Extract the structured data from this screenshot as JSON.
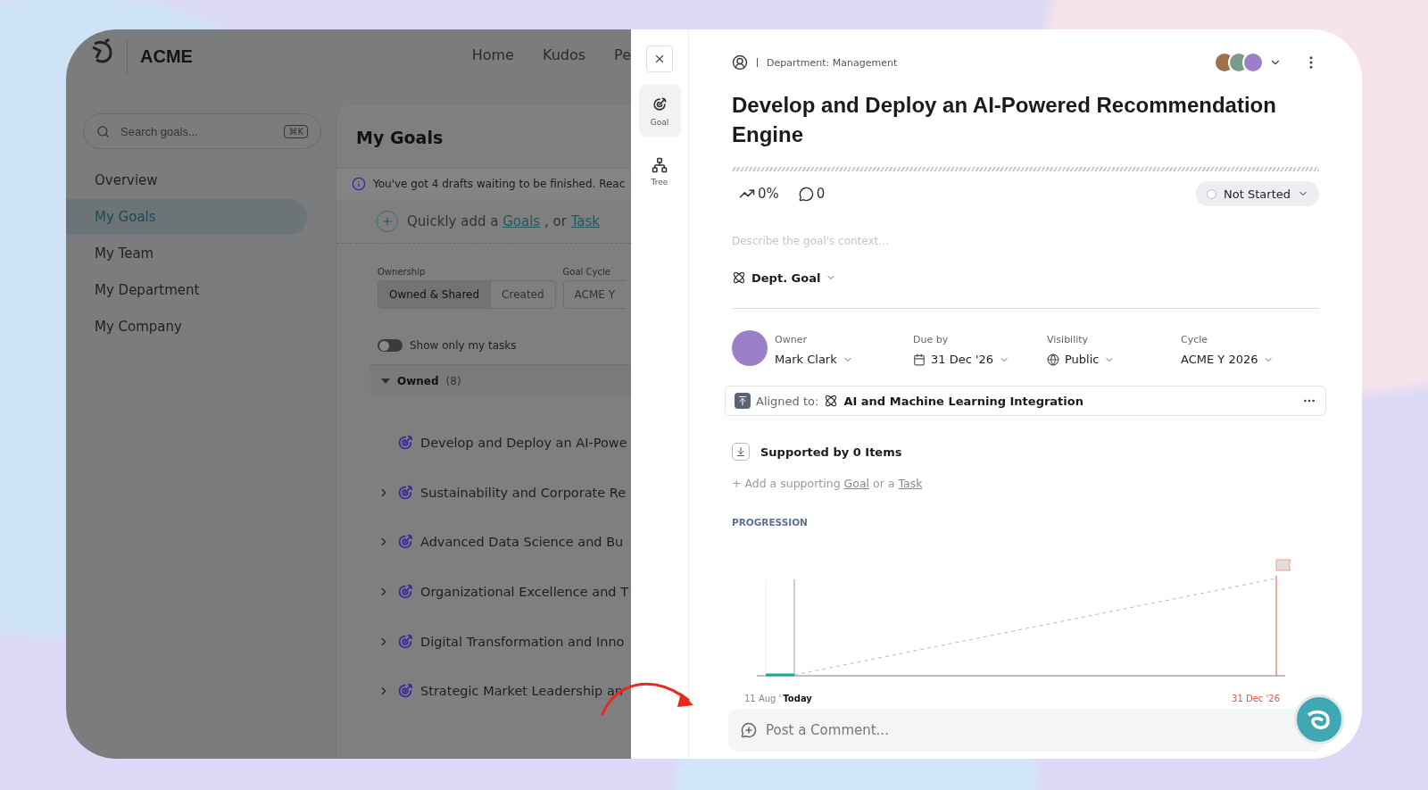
{
  "app": {
    "brand": "ACME",
    "nav": [
      {
        "label": "Home"
      },
      {
        "label": "Kudos"
      },
      {
        "label": "Pe"
      }
    ],
    "search": {
      "placeholder": "Search goals...",
      "shortcut": "⌘K"
    },
    "sidebar": {
      "items": [
        {
          "label": "Overview",
          "selected": false
        },
        {
          "label": "My Goals",
          "selected": true
        },
        {
          "label": "My Team",
          "selected": false
        },
        {
          "label": "My Department",
          "selected": false
        },
        {
          "label": "My Company",
          "selected": false
        }
      ]
    },
    "main": {
      "title": "My Goals",
      "notice": "You've got 4 drafts waiting to be finished. Reac",
      "quick_add": {
        "prefix": "Quickly add a",
        "goal_link": "Goals",
        "separator": ", or",
        "task_link": "Task"
      },
      "ownership": {
        "label": "Ownership",
        "options": [
          {
            "label": "Owned & Shared",
            "selected": true
          },
          {
            "label": "Created",
            "selected": false
          }
        ]
      },
      "goal_cycle": {
        "label": "Goal Cycle",
        "value": "ACME Y"
      },
      "toggle": {
        "label": "Show only my tasks",
        "on": false
      },
      "group": {
        "label": "Owned",
        "count": "(8)",
        "expanded": true
      },
      "goals": [
        {
          "title": "Develop and Deploy an AI-Powe",
          "has_children": false
        },
        {
          "title": "Sustainability and Corporate Re",
          "has_children": true
        },
        {
          "title": "Advanced Data Science and Bu",
          "has_children": true
        },
        {
          "title": "Organizational Excellence and T",
          "has_children": true
        },
        {
          "title": "Digital Transformation and Inno",
          "has_children": true
        },
        {
          "title": "Strategic Market Leadership an",
          "has_children": true
        }
      ]
    }
  },
  "drawer": {
    "tabs": [
      {
        "label": "Goal",
        "selected": true
      },
      {
        "label": "Tree",
        "selected": false
      }
    ],
    "breadcrumb": "Department: Management",
    "title": "Develop and Deploy an AI-Powered Recommendation Engine",
    "progress": "0%",
    "comments": "0",
    "status": "Not Started",
    "context_placeholder": "Describe the goal's context...",
    "goal_type": "Dept. Goal",
    "fields": [
      {
        "kind": "owner",
        "label": "Owner",
        "value": "Mark Clark"
      },
      {
        "kind": "date",
        "label": "Due by",
        "value": "31 Dec '26"
      },
      {
        "kind": "visibility",
        "label": "Visibility",
        "value": "Public"
      },
      {
        "kind": "plain",
        "label": "Cycle",
        "value": "ACME Y 2026"
      }
    ],
    "aligned": {
      "label": "Aligned to:",
      "value": "AI and Machine Learning Integration"
    },
    "supported": {
      "title": "Supported by 0 Items",
      "prefix": "+ Add a supporting",
      "goal_link": "Goal",
      "middle": "or a",
      "task_link": "Task"
    },
    "progression": {
      "title": "PROGRESSION",
      "start_label": "11 Aug '",
      "today_label": "Today",
      "end_label": "31 Dec '26"
    },
    "comment": {
      "placeholder": "Post a Comment..."
    }
  }
}
